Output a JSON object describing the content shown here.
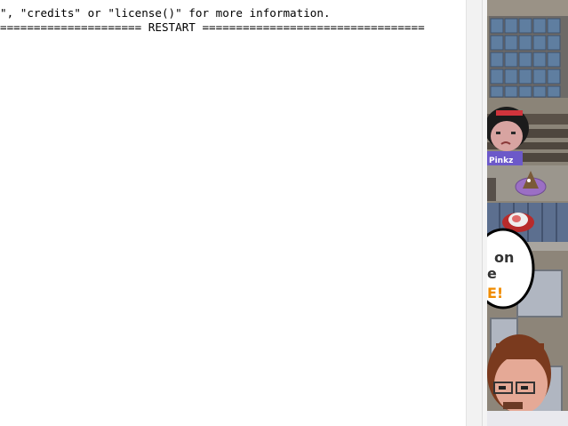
{
  "console": {
    "line1": "\", \"credits\" or \"license()\" for more information.",
    "line2": "===================== RESTART ================================="
  },
  "game": {
    "name_tag": "Pinkz",
    "speech_fragments": [
      "on",
      "e",
      "E!"
    ],
    "colors": {
      "wall": "#8b8478",
      "window": "#5f7ea0",
      "counter": "#5c6f8f",
      "speech_accent": "#f08c00"
    }
  }
}
